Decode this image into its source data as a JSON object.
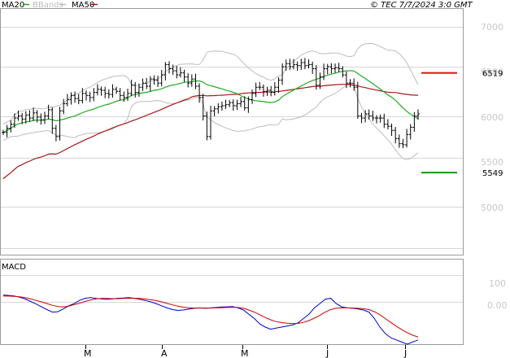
{
  "legend": {
    "ma20": "MA20",
    "bbands": "BBands",
    "ma50": "MA50",
    "ma20_color": "#22aa22",
    "bbands_color": "#bdbdbd",
    "ma50_color": "#a81818"
  },
  "copyright": "© TEC 7/7/2024 3:0 GMT",
  "macd_label": "MACD",
  "chart_data": [
    {
      "type": "ohlc",
      "name": "price",
      "x_labels": [
        "M",
        "A",
        "M",
        "J",
        "J"
      ],
      "y_ticks": [
        "7000",
        "6500",
        "6000",
        "5500",
        "5000"
      ],
      "ylim": [
        4750,
        7150
      ],
      "grid": true,
      "levels": [
        {
          "label": "6519",
          "value": 6519,
          "color": "#dd1111"
        },
        {
          "label": "5549",
          "value": 5549,
          "color": "#119911"
        }
      ],
      "closes": [
        5940,
        5980,
        6020,
        6080,
        6100,
        6070,
        6110,
        6080,
        6130,
        6090,
        6060,
        6100,
        6160,
        5980,
        5900,
        6150,
        6220,
        6260,
        6300,
        6270,
        6250,
        6320,
        6300,
        6280,
        6330,
        6360,
        6350,
        6320,
        6310,
        6360,
        6340,
        6300,
        6280,
        6320,
        6400,
        6330,
        6380,
        6420,
        6390,
        6460,
        6450,
        6420,
        6500,
        6600,
        6560,
        6540,
        6500,
        6520,
        6480,
        6420,
        6460,
        6390,
        6280,
        6100,
        5900,
        6150,
        6170,
        6190,
        6200,
        6210,
        6230,
        6200,
        6220,
        6240,
        6180,
        6260,
        6320,
        6380,
        6380,
        6340,
        6350,
        6330,
        6380,
        6450,
        6580,
        6610,
        6580,
        6600,
        6590,
        6620,
        6590,
        6600,
        6560,
        6400,
        6480,
        6560,
        6580,
        6560,
        6570,
        6560,
        6500,
        6420,
        6420,
        6380,
        6100,
        6080,
        6120,
        6100,
        6080,
        6080,
        6080,
        6020,
        6000,
        5960,
        5880,
        5830,
        5820,
        5920,
        5990,
        6100,
        6120
      ]
    },
    {
      "type": "line",
      "name": "MACD",
      "y_ticks": [
        "100",
        "0.00"
      ],
      "ylim": [
        -180,
        220
      ],
      "series": [
        {
          "name": "MACD",
          "color": "#0000cc",
          "values": [
            50,
            48,
            46,
            40,
            32,
            20,
            8,
            -5,
            -18,
            -30,
            -28,
            -15,
            0,
            10,
            25,
            35,
            38,
            34,
            32,
            30,
            32,
            35,
            36,
            38,
            35,
            30,
            25,
            18,
            10,
            0,
            -10,
            -18,
            -22,
            -20,
            -16,
            -12,
            -10,
            -12,
            -10,
            -8,
            -6,
            -5,
            -4,
            -10,
            -20,
            -40,
            -60,
            -85,
            -100,
            -110,
            -105,
            -100,
            -95,
            -90,
            -80,
            -60,
            -40,
            -10,
            10,
            30,
            35,
            10,
            -5,
            -10,
            -12,
            -15,
            -20,
            -30,
            -60,
            -100,
            -130,
            -150,
            -160,
            -170,
            -180,
            -170,
            -160
          ]
        },
        {
          "name": "Signal",
          "color": "#cc0000",
          "values": [
            45,
            45,
            44,
            42,
            38,
            32,
            25,
            18,
            10,
            2,
            -4,
            -6,
            -2,
            5,
            12,
            20,
            27,
            32,
            34,
            34,
            33,
            33,
            34,
            35,
            35,
            34,
            32,
            28,
            24,
            18,
            11,
            4,
            -2,
            -7,
            -10,
            -11,
            -11,
            -11,
            -11,
            -10,
            -9,
            -8,
            -7,
            -8,
            -12,
            -20,
            -30,
            -42,
            -55,
            -66,
            -74,
            -79,
            -82,
            -84,
            -83,
            -78,
            -70,
            -58,
            -45,
            -30,
            -18,
            -12,
            -10,
            -10,
            -11,
            -12,
            -14,
            -18,
            -28,
            -42,
            -60,
            -78,
            -96,
            -112,
            -126,
            -138,
            -146
          ]
        }
      ]
    }
  ]
}
